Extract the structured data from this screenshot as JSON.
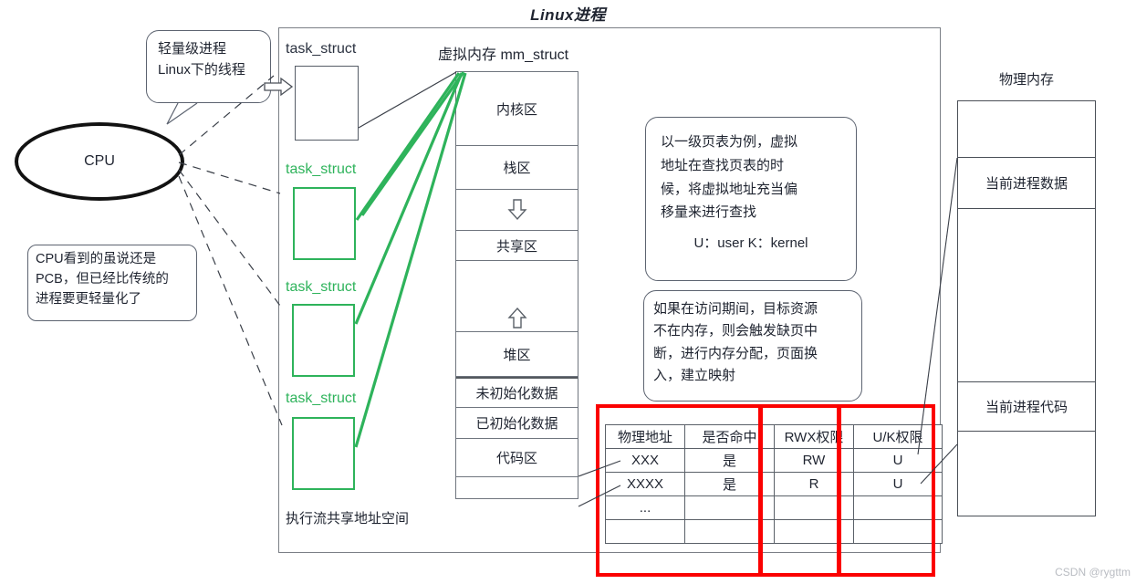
{
  "title": "Linux进程",
  "watermark": "CSDN @rygttm",
  "cpu": {
    "label": "CPU"
  },
  "callouts": {
    "thread": {
      "line1": "轻量级进程",
      "line2": "Linux下的线程"
    },
    "pcb": {
      "line1": "CPU看到的虽说还是",
      "line2": "PCB，但已经比传统的",
      "line3": "进程要更轻量化了"
    },
    "pagetable": {
      "line1": "以一级页表为例，虚拟",
      "line2": "地址在查找页表的时",
      "line3": "候，将虚拟地址充当偏",
      "line4": "移量来进行查找",
      "line5": "U：user  K：kernel"
    },
    "pagefault": {
      "line1": "如果在访问期间，目标资源",
      "line2": "不在内存，则会触发缺页中",
      "line3": "断，进行内存分配，页面换",
      "line4": "入，建立映射"
    }
  },
  "process": {
    "task_struct_label": "task_struct",
    "task_structs": [
      {
        "label": "task_struct",
        "color": "black"
      },
      {
        "label": "task_struct",
        "color": "green"
      },
      {
        "label": "task_struct",
        "color": "green"
      },
      {
        "label": "task_struct",
        "color": "green"
      }
    ],
    "exec_flow_label": "执行流共享地址空间",
    "vm_title": "虚拟内存 mm_struct",
    "vm_regions": [
      {
        "label": "内核区",
        "icon": ""
      },
      {
        "label": "栈区",
        "icon": ""
      },
      {
        "label": "",
        "icon": "arrow-down"
      },
      {
        "label": "共享区",
        "icon": ""
      },
      {
        "label": "",
        "icon": "arrow-up"
      },
      {
        "label": "堆区",
        "icon": ""
      },
      {
        "label": "未初始化数据",
        "icon": ""
      },
      {
        "label": "已初始化数据",
        "icon": ""
      },
      {
        "label": "代码区",
        "icon": ""
      },
      {
        "label": "",
        "icon": ""
      }
    ]
  },
  "page_table": {
    "headers": [
      "物理地址",
      "是否命中",
      "RWX权限",
      "U/K权限"
    ],
    "rows": [
      [
        "XXX",
        "是",
        "RW",
        "U"
      ],
      [
        "XXXX",
        "是",
        "R",
        "U"
      ],
      [
        "...",
        "",
        "",
        ""
      ],
      [
        "",
        "",
        "",
        ""
      ]
    ]
  },
  "physical_memory": {
    "title": "物理内存",
    "cells": [
      "",
      "当前进程数据",
      "",
      "当前进程代码",
      ""
    ]
  },
  "colors": {
    "green": "#2eb35b",
    "red": "#fb0000",
    "frame": "#7b7f86"
  }
}
